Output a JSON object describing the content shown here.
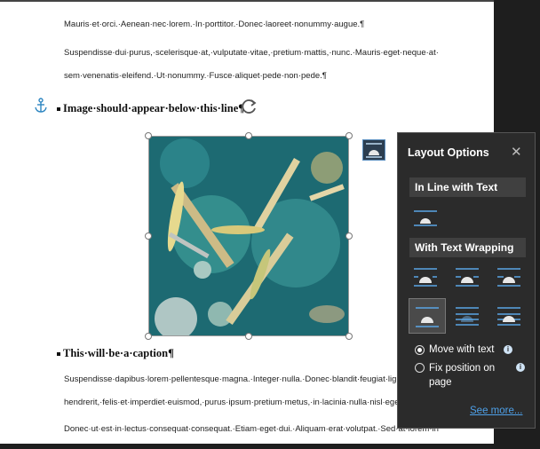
{
  "document": {
    "lines": [
      "Mauris·et·orci.·Aenean·nec·lorem.·In·porttitor.·Donec·laoreet·nonummy·augue.¶",
      "Suspendisse·dui·purus,·scelerisque·at,·vulputate·vitae,·pretium·mattis,·nunc.·Mauris·eget·neque·at·",
      "sem·venenatis·eleifend.·Ut·nonummy.·Fusce·aliquet·pede·non·pede.¶"
    ],
    "heading1": "Image·should·appear·below·this·line¶",
    "heading2": "This·will·be·a·caption¶",
    "lines2": [
      "Suspendisse·dapibus·lorem·pellentesque·magna.·Integer·nulla.·Donec·blandit·feugiat·ligula",
      "hendrerit,·felis·et·imperdiet·euismod,·purus·ipsum·pretium·metus,·in·lacinia·nulla·nisl·eget·",
      "Donec·ut·est·in·lectus·consequat·consequat.·Etiam·eget·dui.·Aliquam·erat·volutpat.·Sed·at·lorem·in"
    ]
  },
  "layout_options": {
    "title": "Layout Options",
    "close_label": "✕",
    "section_inline": "In Line with Text",
    "section_wrapping": "With Text Wrapping",
    "radio_move": "Move with text",
    "radio_fix_line1": "Fix position on",
    "radio_fix_line2": "page",
    "see_more": "See more...",
    "info_glyph": "i"
  },
  "colors": {
    "accent": "#4ea0e8",
    "panel_bg": "#2b2b2b",
    "image_bg": "#1d6a72"
  }
}
